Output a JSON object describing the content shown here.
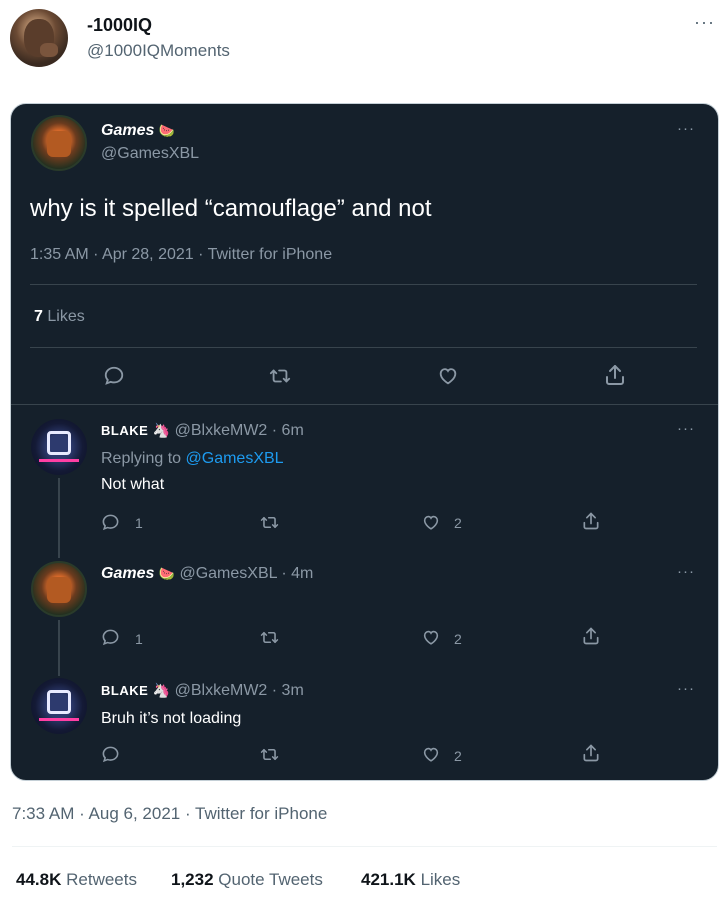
{
  "author": {
    "display_name": "-1000IQ",
    "handle": "@1000IQMoments",
    "more": "···"
  },
  "quoted": {
    "main": {
      "display_name": "Games",
      "emoji": "🍉",
      "handle": "@GamesXBL",
      "text": "why is it spelled “camouflage” and not",
      "timestamp": "1:35 AM · Apr 28, 2021 · Twitter for iPhone",
      "likes_count": "7",
      "likes_label": "Likes",
      "more": "···"
    },
    "replies": [
      {
        "display_name": "BLAKE",
        "emoji": "🦄",
        "handle_time": "@BlxkeMW2 · 6m",
        "replying_prefix": "Replying to",
        "replying_to": "@GamesXBL",
        "text": "Not what",
        "reply_count": "1",
        "like_count": "2",
        "more": "···"
      },
      {
        "display_name": "Games",
        "emoji": "🍉",
        "handle_time": "@GamesXBL · 4m",
        "reply_count": "1",
        "like_count": "2",
        "more": "···"
      },
      {
        "display_name": "BLAKE",
        "emoji": "🦄",
        "handle_time": "@BlxkeMW2 · 3m",
        "text": "Bruh it’s not loading",
        "like_count": "2",
        "more": "···"
      }
    ]
  },
  "footer": {
    "timestamp": "7:33 AM · Aug 6, 2021 · Twitter for iPhone",
    "retweets_num": "44.8K",
    "retweets_label": "Retweets",
    "quotes_num": "1,232",
    "quotes_label": "Quote Tweets",
    "likes_num": "421.1K",
    "likes_label": "Likes"
  },
  "icons": [
    "reply-icon",
    "retweet-icon",
    "like-icon",
    "share-icon",
    "more-icon"
  ],
  "colors": {
    "card_bg": "#15202b",
    "link": "#1d9bf0",
    "muted": "#8b98a5"
  }
}
